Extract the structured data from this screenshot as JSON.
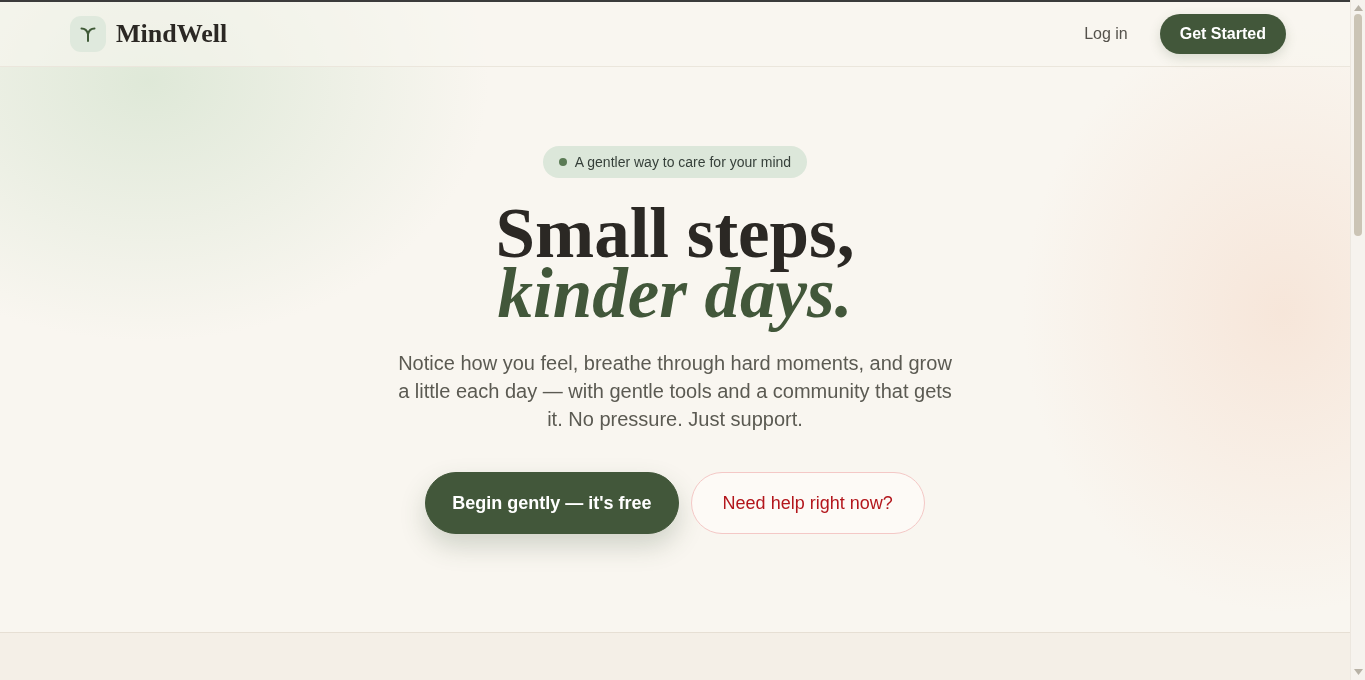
{
  "header": {
    "logo": {
      "name": "MindWell"
    },
    "nav": [
      {
        "label": "Log in",
        "kind": "link"
      },
      {
        "label": "Get Started",
        "kind": "button"
      }
    ]
  },
  "hero": {
    "badge": "A gentler way to care for your mind",
    "headline": {
      "line_1": "Small steps,",
      "line_2": "kinder days."
    },
    "lead": "Notice how you feel, breathe through hard moments, and grow a little each day — with gentle tools and a community that gets it. No pressure. Just support.",
    "actions": [
      {
        "label": "Begin gently — it's free",
        "kind": "primary"
      },
      {
        "label": "Need help right now?",
        "kind": "crisis"
      }
    ]
  }
}
